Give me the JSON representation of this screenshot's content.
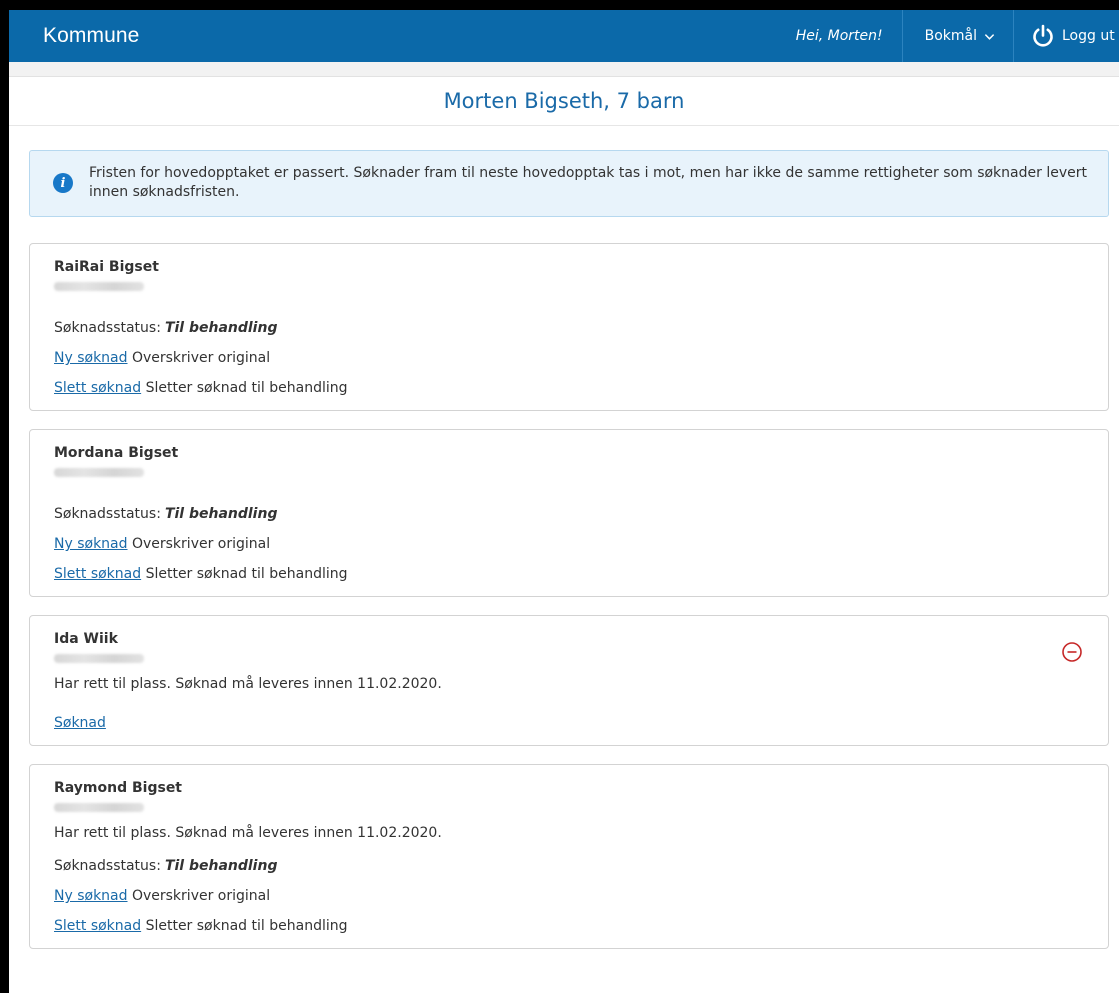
{
  "header": {
    "brand": "Kommune",
    "greeting": "Hei, Morten!",
    "language": "Bokmål",
    "logout_label": "Logg ut"
  },
  "page_title": "Morten Bigseth, 7 barn",
  "alert": {
    "text": "Fristen for hovedopptaket er passert. Søknader fram til neste hovedopptak tas i mot, men har ikke de samme rettigheter som søknader levert innen søknadsfristen."
  },
  "children": [
    {
      "name": "RaiRai Bigset",
      "status_label": "Søknadsstatus:",
      "status_value": "Til behandling",
      "new_link": "Ny søknad",
      "new_desc": "Overskriver original",
      "delete_link": "Slett søknad",
      "delete_desc": "Sletter søknad til behandling"
    },
    {
      "name": "Mordana Bigset",
      "status_label": "Søknadsstatus:",
      "status_value": "Til behandling",
      "new_link": "Ny søknad",
      "new_desc": "Overskriver original",
      "delete_link": "Slett søknad",
      "delete_desc": "Sletter søknad til behandling"
    },
    {
      "name": "Ida Wiik",
      "right_msg": "Har rett til plass. Søknad må leveres innen 11.02.2020.",
      "apply_link": "Søknad"
    },
    {
      "name": "Raymond Bigset",
      "right_msg": "Har rett til plass. Søknad må leveres innen 11.02.2020.",
      "status_label": "Søknadsstatus:",
      "status_value": "Til behandling",
      "new_link": "Ny søknad",
      "new_desc": "Overskriver original",
      "delete_link": "Slett søknad",
      "delete_desc": "Sletter søknad til behandling"
    }
  ],
  "colors": {
    "header_bg": "#0b69a9",
    "title_color": "#1a6aa8",
    "link_color": "#1a6aa8",
    "alert_bg": "#e8f3fb",
    "remove_icon": "#c62828"
  }
}
